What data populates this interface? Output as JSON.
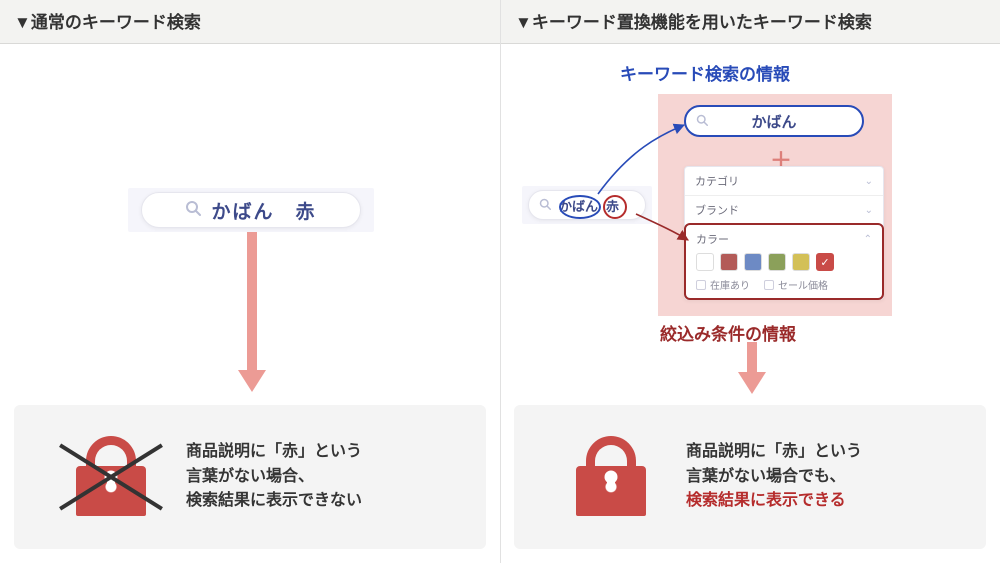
{
  "left": {
    "header": "▼通常のキーワード検索",
    "search_text": "かばん　赤",
    "result_line1": "商品説明に「赤」という",
    "result_line2": "言葉がない場合、",
    "result_line3": "検索結果に表示できない"
  },
  "right": {
    "header": "▼キーワード置換機能を用いたキーワード検索",
    "top_label": "キーワード検索の情報",
    "bottom_label": "絞込み条件の情報",
    "mini_search_word1": "かばん",
    "mini_search_word2": "赤",
    "kaban_pill_text": "かばん",
    "plus": "＋",
    "filters": {
      "cat": "カテゴリ",
      "brand": "ブランド",
      "color": "カラー",
      "stock": "在庫あり",
      "sale": "セール価格"
    },
    "swatches": [
      "#ffffff",
      "#b35b58",
      "#6d8ac4",
      "#8ba05a",
      "#d3c057",
      "#c94b47"
    ],
    "swatch_selected_index": 5,
    "result_line1": "商品説明に「赤」という",
    "result_line2": "言葉がない場合でも、",
    "result_line3": "検索結果に表示できる"
  }
}
